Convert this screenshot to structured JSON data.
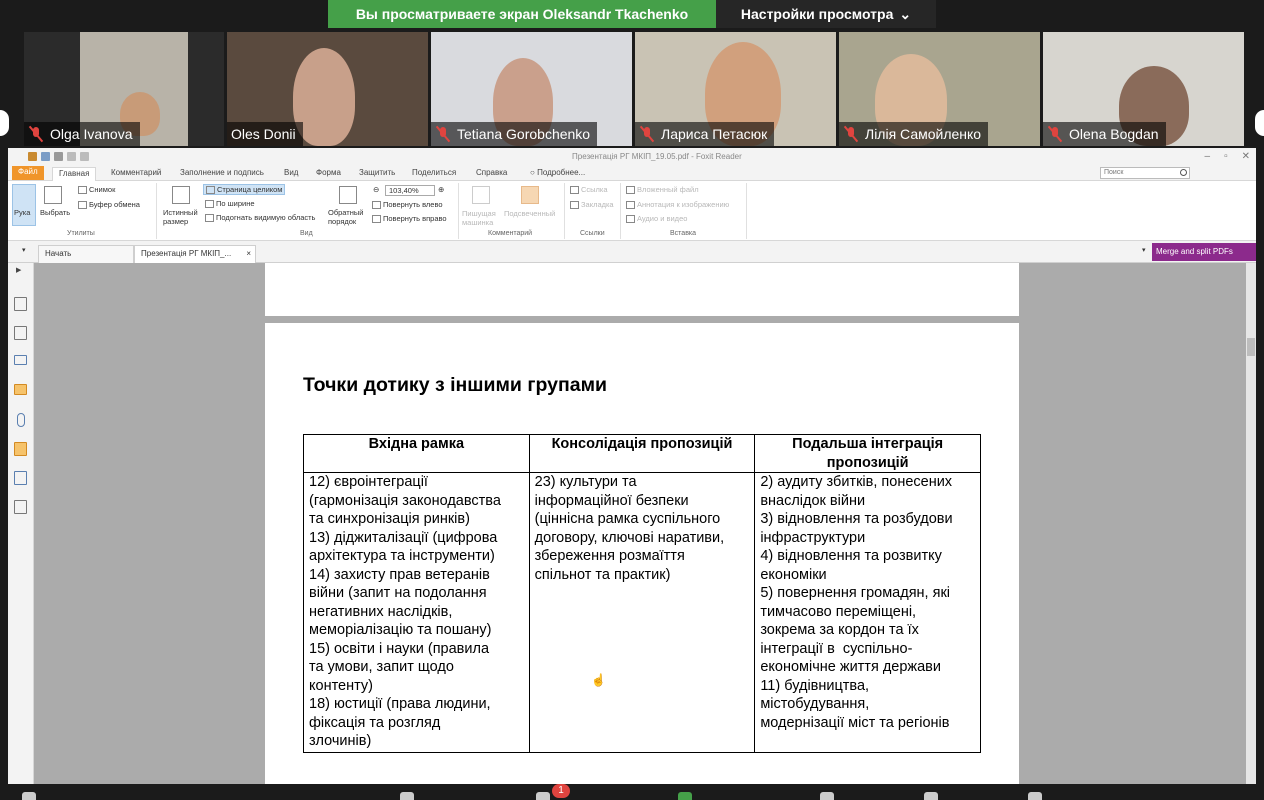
{
  "share": {
    "message": "Вы просматриваете экран Oleksandr Tkachenko",
    "settings_label": "Настройки просмотра",
    "banner_color": "#45a049"
  },
  "participants": [
    {
      "name": "Olga Ivanova",
      "muted": true
    },
    {
      "name": "Oles Donii",
      "muted": false
    },
    {
      "name": "Tetiana Gorobchenko",
      "muted": true
    },
    {
      "name": "Лариса Петасюк",
      "muted": true
    },
    {
      "name": "Лілія Самойленко",
      "muted": true
    },
    {
      "name": "Olena Bogdan",
      "muted": true
    }
  ],
  "foxit": {
    "window_title": "Презентація РГ МКІП_19.05.pdf - Foxit Reader",
    "menu": [
      "Файл",
      "Главная",
      "Комментарий",
      "Заполнение и подпись",
      "Вид",
      "Форма",
      "Защитить",
      "Поделиться",
      "Справка",
      "Подробнее..."
    ],
    "search_placeholder": "Поиск",
    "ribbon": {
      "hand": "Рука",
      "select": "Выбрать",
      "snapshot": "Снимок",
      "clipboard": "Буфер обмена",
      "group_tools": "Утилиты",
      "actual_size": "Истинный размер",
      "fit_page": "Страница целиком",
      "fit_width": "По ширине",
      "fit_visible": "Подогнать видимую область",
      "reflow": "Обратный порядок",
      "zoom": "103,40%",
      "rotate_left": "Повернуть влево",
      "rotate_right": "Повернуть вправо",
      "group_view": "Вид",
      "typewriter": "Пишущая машинка",
      "highlight": "Подсвеченный",
      "group_comment": "Комментарий",
      "link": "Ссылка",
      "bookmark": "Закладка",
      "group_links": "Ссылки",
      "attach_file": "Вложенный файл",
      "image_annot": "Аннотация к изображению",
      "audio_video": "Аудио и видео",
      "group_insert": "Вставка"
    },
    "tabs": {
      "start": "Начать",
      "doc": "Презентація РГ МКІП_..."
    },
    "merge_label": "Merge and split PDFs"
  },
  "document": {
    "title": "Точки дотику з іншими групами",
    "headers": [
      "Вхідна рамка",
      "Консолідація пропозицій",
      "Подальша інтеграція пропозицій"
    ],
    "col1": [
      "12) євроінтеграції",
      "(гармонізація законодавства",
      "та синхронізація ринків)",
      "13) діджиталізації (цифрова",
      "архітектура та інструменти)",
      "14) захисту прав ветеранів",
      "війни (запит на подолання",
      "негативних наслідків,",
      "меморіалізацію та пошану)",
      "15) освіти і науки (правила",
      "та умови, запит щодо",
      "контенту)",
      "18) юстиції (права людини,",
      "фіксація та розгляд",
      "злочинів)"
    ],
    "col2": [
      "23) культури та",
      "інформаційної безпеки",
      "(ціннісна рамка суспільного",
      "договору, ключові наративи,",
      "збереження розмаїття",
      "спільнот та практик)"
    ],
    "col3": [
      "2) аудиту збитків, понесених",
      "внаслідок війни",
      "3) відновлення та розбудови",
      "інфраструктури",
      "4) відновлення та розвитку",
      "економіки",
      "5) повернення громадян, які",
      "тимчасово переміщені,",
      "зокрема за кордон та їх",
      "інтеграції в  суспільно-",
      "економічне життя держави",
      "11) будівництва,",
      "містобудування,",
      "модернізації міст та регіонів"
    ]
  },
  "bottom": {
    "chat_badge": "1"
  }
}
